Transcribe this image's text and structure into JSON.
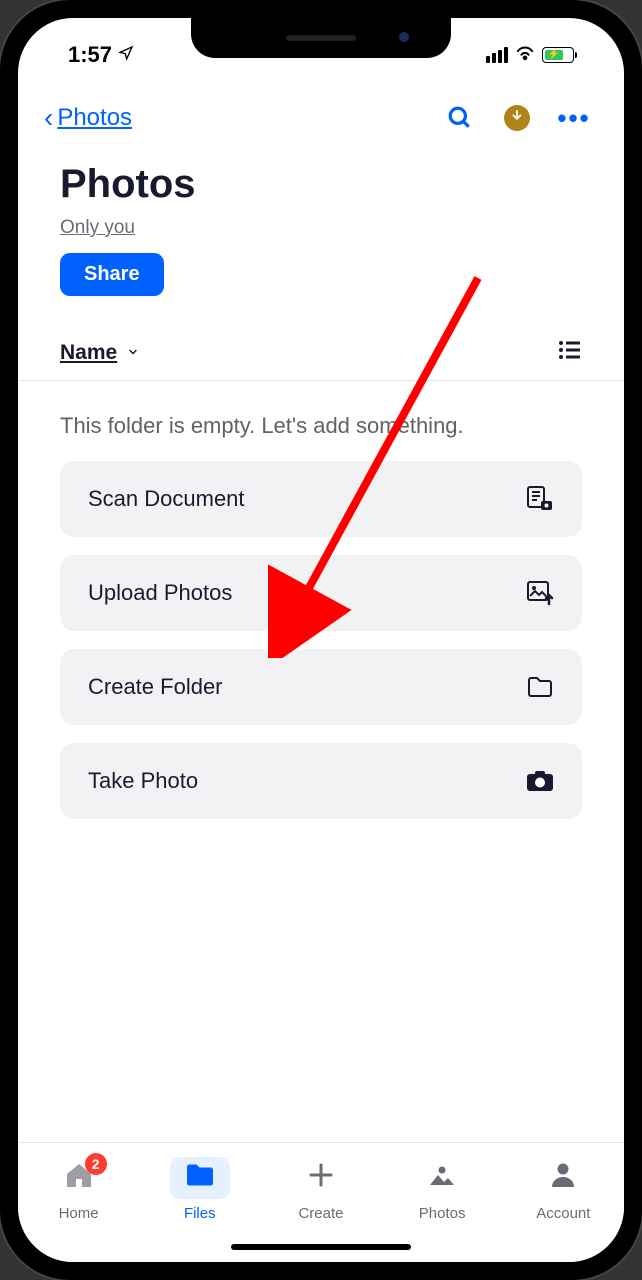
{
  "status": {
    "time": "1:57",
    "location_icon": "location-arrow"
  },
  "nav": {
    "back_label": "Photos"
  },
  "header": {
    "title": "Photos",
    "sharing": "Only you",
    "share_button": "Share"
  },
  "sort": {
    "label": "Name"
  },
  "empty": {
    "message": "This folder is empty. Let's add something."
  },
  "actions": [
    {
      "label": "Scan Document",
      "icon": "scan-document-icon"
    },
    {
      "label": "Upload Photos",
      "icon": "upload-photo-icon"
    },
    {
      "label": "Create Folder",
      "icon": "folder-icon"
    },
    {
      "label": "Take Photo",
      "icon": "camera-icon"
    }
  ],
  "tabs": [
    {
      "label": "Home",
      "icon": "home-icon",
      "badge": "2",
      "active": false
    },
    {
      "label": "Files",
      "icon": "folder-filled-icon",
      "active": true
    },
    {
      "label": "Create",
      "icon": "plus-icon",
      "active": false
    },
    {
      "label": "Photos",
      "icon": "image-icon",
      "active": false
    },
    {
      "label": "Account",
      "icon": "person-icon",
      "active": false
    }
  ]
}
